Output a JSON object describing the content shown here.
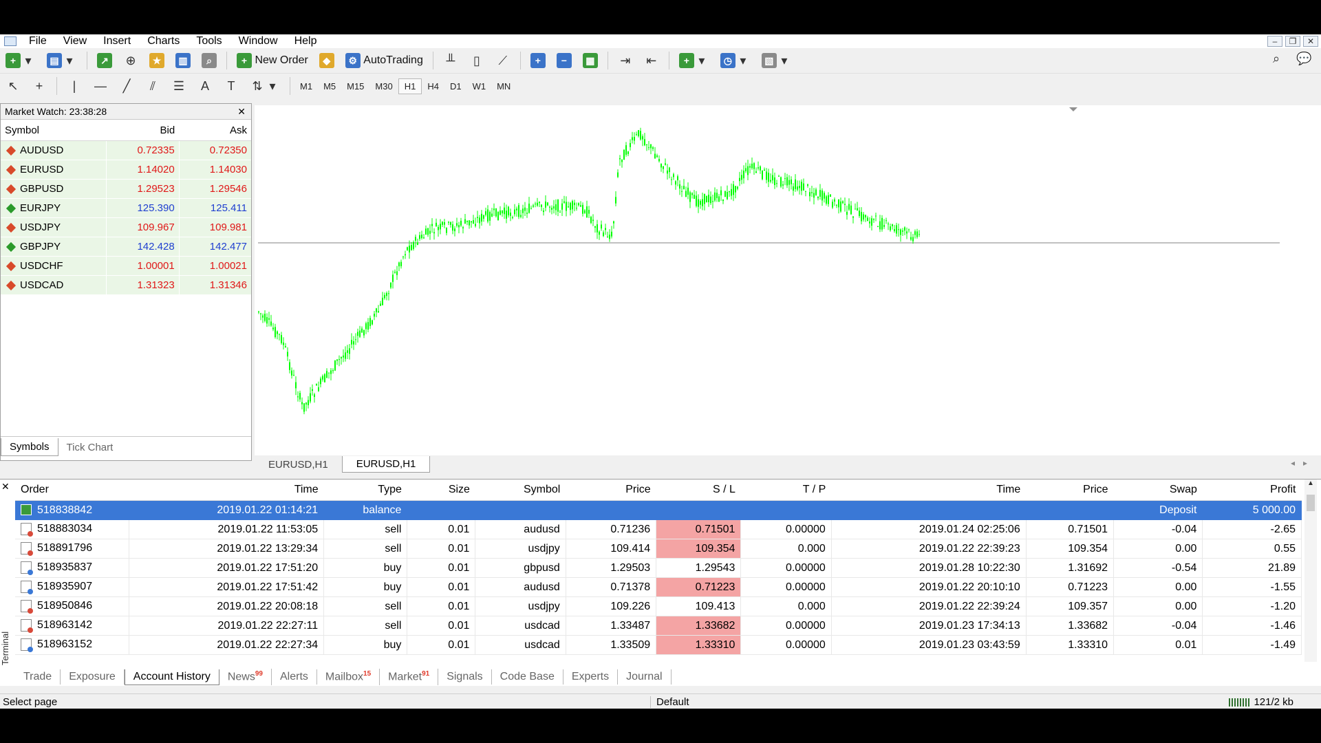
{
  "menu": [
    "File",
    "View",
    "Insert",
    "Charts",
    "Tools",
    "Window",
    "Help"
  ],
  "toolbar": {
    "new_order": "New Order",
    "autotrading": "AutoTrading"
  },
  "timeframes": [
    "M1",
    "M5",
    "M15",
    "M30",
    "H1",
    "H4",
    "D1",
    "W1",
    "MN"
  ],
  "active_timeframe": "H1",
  "market_watch": {
    "title": "Market Watch: 23:38:28",
    "headers": [
      "Symbol",
      "Bid",
      "Ask"
    ],
    "rows": [
      {
        "symbol": "AUDUSD",
        "bid": "0.72335",
        "ask": "0.72350",
        "dir": "down"
      },
      {
        "symbol": "EURUSD",
        "bid": "1.14020",
        "ask": "1.14030",
        "dir": "down"
      },
      {
        "symbol": "GBPUSD",
        "bid": "1.29523",
        "ask": "1.29546",
        "dir": "down"
      },
      {
        "symbol": "EURJPY",
        "bid": "125.390",
        "ask": "125.411",
        "dir": "up"
      },
      {
        "symbol": "USDJPY",
        "bid": "109.967",
        "ask": "109.981",
        "dir": "down"
      },
      {
        "symbol": "GBPJPY",
        "bid": "142.428",
        "ask": "142.477",
        "dir": "up"
      },
      {
        "symbol": "USDCHF",
        "bid": "1.00001",
        "ask": "1.00021",
        "dir": "down"
      },
      {
        "symbol": "USDCAD",
        "bid": "1.31323",
        "ask": "1.31346",
        "dir": "down"
      }
    ],
    "tabs": [
      "Symbols",
      "Tick Chart"
    ]
  },
  "chart_tabs": [
    "EURUSD,H1",
    "EURUSD,H1"
  ],
  "colors": {
    "up": "#2a9a2a",
    "down": "#d84a2a",
    "bid_up": "#1f3fd0",
    "bid_down": "#e01818",
    "selection": "#3a78d6",
    "sl_hit": "#f4a4a4",
    "candle": "#00ff00"
  },
  "terminal": {
    "label": "Terminal",
    "headers": [
      "Order",
      "Time",
      "Type",
      "Size",
      "Symbol",
      "Price",
      "S / L",
      "T / P",
      "Time",
      "Price",
      "Swap",
      "Profit"
    ],
    "rows": [
      {
        "order": "518838842",
        "time": "2019.01.22 01:14:21",
        "type": "balance",
        "size": "",
        "symbol": "",
        "price": "",
        "sl": "",
        "tp": "",
        "ctime": "",
        "cprice": "",
        "swap": "Deposit",
        "profit": "5 000.00",
        "kind": "balance"
      },
      {
        "order": "518883034",
        "time": "2019.01.22 11:53:05",
        "type": "sell",
        "size": "0.01",
        "symbol": "audusd",
        "price": "0.71236",
        "sl": "0.71501",
        "tp": "0.00000",
        "ctime": "2019.01.24 02:25:06",
        "cprice": "0.71501",
        "swap": "-0.04",
        "profit": "-2.65",
        "kind": "sell",
        "sl_hit": true
      },
      {
        "order": "518891796",
        "time": "2019.01.22 13:29:34",
        "type": "sell",
        "size": "0.01",
        "symbol": "usdjpy",
        "price": "109.414",
        "sl": "109.354",
        "tp": "0.000",
        "ctime": "2019.01.22 22:39:23",
        "cprice": "109.354",
        "swap": "0.00",
        "profit": "0.55",
        "kind": "sell",
        "sl_hit": true
      },
      {
        "order": "518935837",
        "time": "2019.01.22 17:51:20",
        "type": "buy",
        "size": "0.01",
        "symbol": "gbpusd",
        "price": "1.29503",
        "sl": "1.29543",
        "tp": "0.00000",
        "ctime": "2019.01.28 10:22:30",
        "cprice": "1.31692",
        "swap": "-0.54",
        "profit": "21.89",
        "kind": "buy",
        "sl_hit": false
      },
      {
        "order": "518935907",
        "time": "2019.01.22 17:51:42",
        "type": "buy",
        "size": "0.01",
        "symbol": "audusd",
        "price": "0.71378",
        "sl": "0.71223",
        "tp": "0.00000",
        "ctime": "2019.01.22 20:10:10",
        "cprice": "0.71223",
        "swap": "0.00",
        "profit": "-1.55",
        "kind": "buy",
        "sl_hit": true
      },
      {
        "order": "518950846",
        "time": "2019.01.22 20:08:18",
        "type": "sell",
        "size": "0.01",
        "symbol": "usdjpy",
        "price": "109.226",
        "sl": "109.413",
        "tp": "0.000",
        "ctime": "2019.01.22 22:39:24",
        "cprice": "109.357",
        "swap": "0.00",
        "profit": "-1.20",
        "kind": "sell",
        "sl_hit": false
      },
      {
        "order": "518963142",
        "time": "2019.01.22 22:27:11",
        "type": "sell",
        "size": "0.01",
        "symbol": "usdcad",
        "price": "1.33487",
        "sl": "1.33682",
        "tp": "0.00000",
        "ctime": "2019.01.23 17:34:13",
        "cprice": "1.33682",
        "swap": "-0.04",
        "profit": "-1.46",
        "kind": "sell",
        "sl_hit": true
      },
      {
        "order": "518963152",
        "time": "2019.01.22 22:27:34",
        "type": "buy",
        "size": "0.01",
        "symbol": "usdcad",
        "price": "1.33509",
        "sl": "1.33310",
        "tp": "0.00000",
        "ctime": "2019.01.23 03:43:59",
        "cprice": "1.33310",
        "swap": "0.01",
        "profit": "-1.49",
        "kind": "buy",
        "sl_hit": true
      }
    ],
    "tabs": [
      {
        "label": "Trade",
        "badge": ""
      },
      {
        "label": "Exposure",
        "badge": ""
      },
      {
        "label": "Account History",
        "badge": "",
        "active": true
      },
      {
        "label": "News",
        "badge": "99"
      },
      {
        "label": "Alerts",
        "badge": ""
      },
      {
        "label": "Mailbox",
        "badge": "15"
      },
      {
        "label": "Market",
        "badge": "91"
      },
      {
        "label": "Signals",
        "badge": ""
      },
      {
        "label": "Code Base",
        "badge": ""
      },
      {
        "label": "Experts",
        "badge": ""
      },
      {
        "label": "Journal",
        "badge": ""
      }
    ]
  },
  "status": {
    "left": "Select page",
    "profile": "Default",
    "connection": "121/2 kb"
  }
}
